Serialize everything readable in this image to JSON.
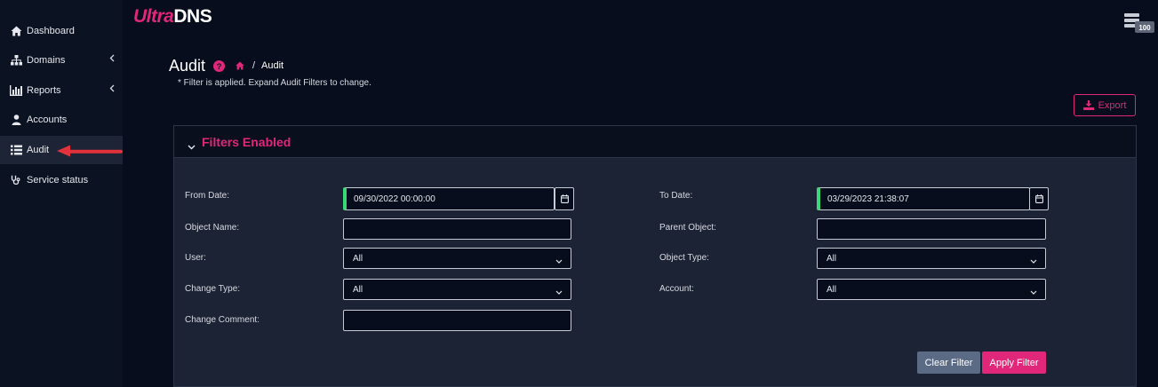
{
  "app": {
    "logo_part1": "Ultra",
    "logo_part2": "DNS",
    "server_badge": "100"
  },
  "sidebar": {
    "items": [
      {
        "label": "Dashboard",
        "icon": "home-icon"
      },
      {
        "label": "Domains",
        "icon": "sitemap-icon",
        "expandable": true
      },
      {
        "label": "Reports",
        "icon": "bar-chart-icon",
        "expandable": true
      },
      {
        "label": "Accounts",
        "icon": "user-icon"
      },
      {
        "label": "Audit",
        "icon": "list-icon",
        "active": true
      },
      {
        "label": "Service status",
        "icon": "stethoscope-icon"
      }
    ]
  },
  "header": {
    "title": "Audit",
    "breadcrumb_sep": "/",
    "breadcrumb_current": "Audit",
    "filter_note": "* Filter is applied. Expand Audit Filters to change.",
    "export_label": "Export"
  },
  "filters": {
    "title": "Filters Enabled",
    "from_date_label": "From Date:",
    "from_date_value": "09/30/2022 00:00:00",
    "to_date_label": "To Date:",
    "to_date_value": "03/29/2023 21:38:07",
    "object_name_label": "Object Name:",
    "object_name_value": "",
    "parent_object_label": "Parent Object:",
    "parent_object_value": "",
    "user_label": "User:",
    "user_value": "All",
    "object_type_label": "Object Type:",
    "object_type_value": "All",
    "change_type_label": "Change Type:",
    "change_type_value": "All",
    "account_label": "Account:",
    "account_value": "All",
    "change_comment_label": "Change Comment:",
    "change_comment_value": "",
    "clear_label": "Clear Filter",
    "apply_label": "Apply Filter"
  },
  "colors": {
    "accent": "#e0277a",
    "date_indicator": "#3ad67a",
    "background": "#070d1c",
    "panel": "#1c2334"
  }
}
